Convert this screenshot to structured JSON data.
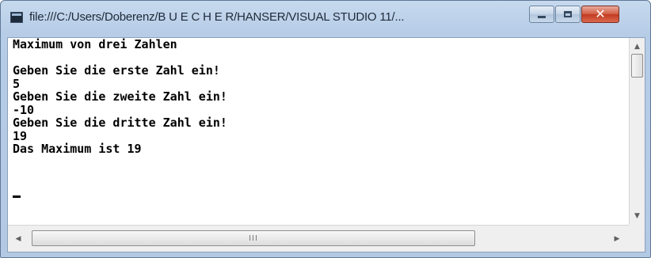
{
  "window": {
    "title": "file:///C:/Users/Doberenz/B U E C H E R/HANSER/VISUAL STUDIO 11/...",
    "minimize_icon": "minimize-icon",
    "maximize_icon": "maximize-icon",
    "close_icon": "close-icon",
    "close_glyph": "✕"
  },
  "console": {
    "lines": [
      "Maximum von drei Zahlen",
      "",
      "Geben Sie die erste Zahl ein!",
      "5",
      "Geben Sie die zweite Zahl ein!",
      "-10",
      "Geben Sie die dritte Zahl ein!",
      "19",
      "Das Maximum ist 19"
    ]
  },
  "scrollbars": {
    "up_arrow": "▲",
    "down_arrow": "▼",
    "left_arrow": "◀",
    "right_arrow": "▶",
    "grip": "III"
  }
}
